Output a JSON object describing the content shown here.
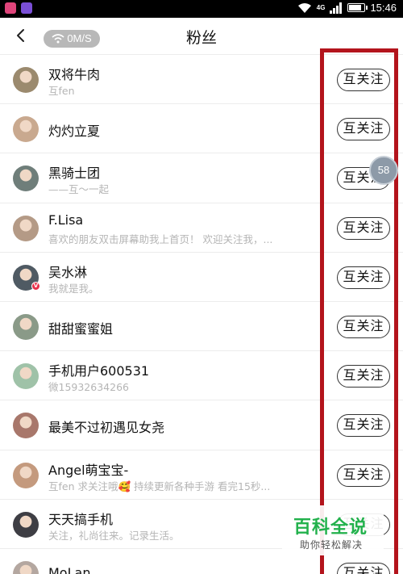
{
  "status_bar": {
    "network": "4G",
    "time": "15:46",
    "battery_level": 0.8
  },
  "header": {
    "speed": "0M/S",
    "title": "粉丝"
  },
  "follow_label": "互关注",
  "fans": [
    {
      "name": "双将牛肉",
      "bio": "互fen",
      "avatar_color": "#9b8a6e",
      "verified": false
    },
    {
      "name": "灼灼立夏",
      "bio": "",
      "avatar_color": "#c9a98f",
      "verified": false
    },
    {
      "name": "黑骑士团",
      "bio": "——互～一起",
      "avatar_color": "#6f7e7a",
      "verified": false
    },
    {
      "name": "F.Lisa",
      "bio": "喜欢的朋友双击屏幕助我上首页！ 欢迎关注我，...",
      "avatar_color": "#b49a86",
      "verified": false
    },
    {
      "name": "吴水淋",
      "bio": "我就是我。",
      "avatar_color": "#4f5a63",
      "verified": true
    },
    {
      "name": "甜甜蜜蜜姐",
      "bio": "",
      "avatar_color": "#8a9a88",
      "verified": false
    },
    {
      "name": "手机用户600531",
      "bio": "微15932634266",
      "avatar_color": "#9fc2a8",
      "verified": false
    },
    {
      "name": "最美不过初遇见女尧",
      "bio": "",
      "avatar_color": "#a8776b",
      "verified": false
    },
    {
      "name": "Angel萌宝宝-",
      "bio": "互fen 求关注哦🥰 持续更新各种手游 看完15秒...",
      "avatar_color": "#c49a7e",
      "verified": false
    },
    {
      "name": "天天搞手机",
      "bio": "关注，礼尚往来。记录生活。",
      "avatar_color": "#3e3e44",
      "verified": false
    },
    {
      "name": "MoLan",
      "bio": "",
      "avatar_color": "#b4a7a0",
      "verified": false
    }
  ],
  "float_bubble": "58",
  "watermark": {
    "title": "百科全说",
    "subtitle": "助你轻松解决"
  },
  "colors": {
    "highlight": "#b3141c",
    "watermark_green": "#22b14c",
    "verified_red": "#e8304b"
  }
}
